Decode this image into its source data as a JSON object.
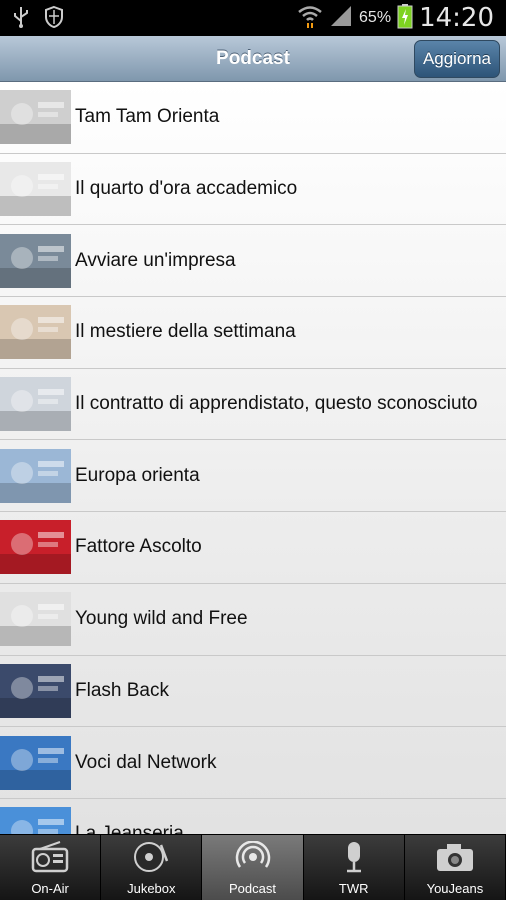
{
  "status": {
    "battery": "65%",
    "time": "14:20"
  },
  "header": {
    "title": "Podcast",
    "refresh_label": "Aggiorna"
  },
  "items": [
    {
      "label": "Tam Tam Orienta",
      "thumb_color": "#cfcfcf"
    },
    {
      "label": "Il quarto d'ora accademico",
      "thumb_color": "#e8e8e8"
    },
    {
      "label": "Avviare un'impresa",
      "thumb_color": "#7a8a99"
    },
    {
      "label": "Il mestiere della settimana",
      "thumb_color": "#d9c7b2"
    },
    {
      "label": "Il contratto di apprendistato, questo sconosciuto",
      "thumb_color": "#cfd5dc"
    },
    {
      "label": "Europa orienta",
      "thumb_color": "#9bb7d6"
    },
    {
      "label": "Fattore Ascolto",
      "thumb_color": "#c81f2a"
    },
    {
      "label": "Young wild and Free",
      "thumb_color": "#e0e0e0"
    },
    {
      "label": "Flash Back",
      "thumb_color": "#3b4a6b"
    },
    {
      "label": "Voci dal Network",
      "thumb_color": "#3a78c2"
    },
    {
      "label": "La Jeanseria",
      "thumb_color": "#4a90d9"
    }
  ],
  "tabs": [
    {
      "label": "On-Air",
      "icon": "radio-icon"
    },
    {
      "label": "Jukebox",
      "icon": "vinyl-icon"
    },
    {
      "label": "Podcast",
      "icon": "podcast-icon",
      "active": true
    },
    {
      "label": "TWR",
      "icon": "microphone-icon"
    },
    {
      "label": "YouJeans",
      "icon": "camera-icon"
    }
  ]
}
